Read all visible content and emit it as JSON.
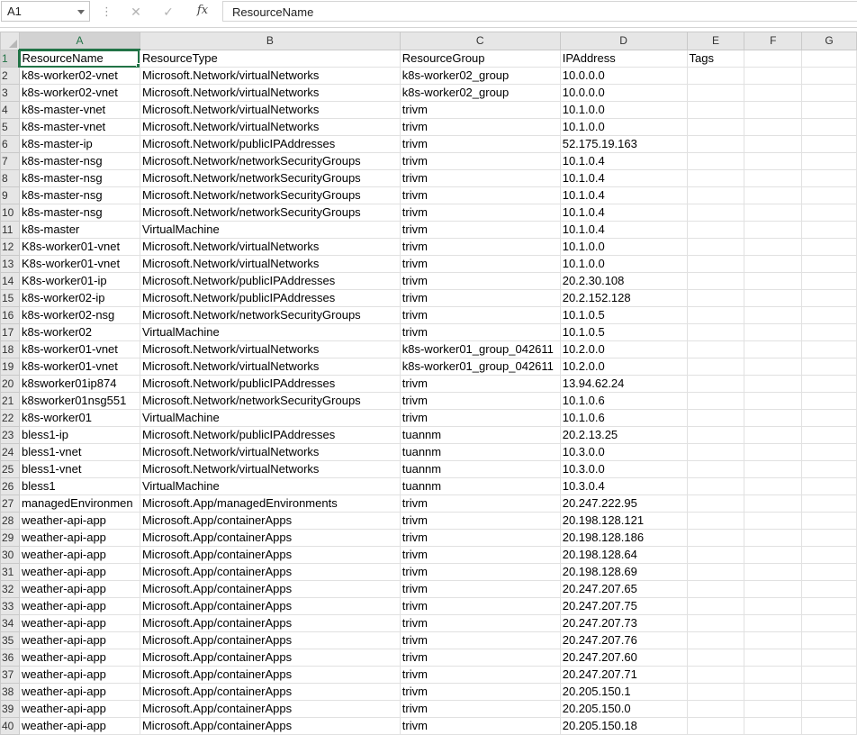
{
  "formula_bar": {
    "name_box": "A1",
    "fx_label": "fx",
    "cancel_icon": "x-icon",
    "enter_icon": "check-icon",
    "content": "ResourceName"
  },
  "columns": [
    "A",
    "B",
    "C",
    "D",
    "E",
    "F",
    "G"
  ],
  "rows": [
    {
      "n": "1",
      "cells": [
        "ResourceName",
        "ResourceType",
        "ResourceGroup",
        "IPAddress",
        "Tags",
        "",
        ""
      ]
    },
    {
      "n": "2",
      "cells": [
        "k8s-worker02-vnet",
        "Microsoft.Network/virtualNetworks",
        "k8s-worker02_group",
        "10.0.0.0",
        "",
        "",
        ""
      ]
    },
    {
      "n": "3",
      "cells": [
        "k8s-worker02-vnet",
        "Microsoft.Network/virtualNetworks",
        "k8s-worker02_group",
        "10.0.0.0",
        "",
        "",
        ""
      ]
    },
    {
      "n": "4",
      "cells": [
        "k8s-master-vnet",
        "Microsoft.Network/virtualNetworks",
        "trivm",
        "10.1.0.0",
        "",
        "",
        ""
      ]
    },
    {
      "n": "5",
      "cells": [
        "k8s-master-vnet",
        "Microsoft.Network/virtualNetworks",
        "trivm",
        "10.1.0.0",
        "",
        "",
        ""
      ]
    },
    {
      "n": "6",
      "cells": [
        "k8s-master-ip",
        "Microsoft.Network/publicIPAddresses",
        "trivm",
        "52.175.19.163",
        "",
        "",
        ""
      ]
    },
    {
      "n": "7",
      "cells": [
        "k8s-master-nsg",
        "Microsoft.Network/networkSecurityGroups",
        "trivm",
        "10.1.0.4",
        "",
        "",
        ""
      ]
    },
    {
      "n": "8",
      "cells": [
        "k8s-master-nsg",
        "Microsoft.Network/networkSecurityGroups",
        "trivm",
        "10.1.0.4",
        "",
        "",
        ""
      ]
    },
    {
      "n": "9",
      "cells": [
        "k8s-master-nsg",
        "Microsoft.Network/networkSecurityGroups",
        "trivm",
        "10.1.0.4",
        "",
        "",
        ""
      ]
    },
    {
      "n": "10",
      "cells": [
        "k8s-master-nsg",
        "Microsoft.Network/networkSecurityGroups",
        "trivm",
        "10.1.0.4",
        "",
        "",
        ""
      ]
    },
    {
      "n": "11",
      "cells": [
        "k8s-master",
        "VirtualMachine",
        "trivm",
        "10.1.0.4",
        "",
        "",
        ""
      ]
    },
    {
      "n": "12",
      "cells": [
        "K8s-worker01-vnet",
        "Microsoft.Network/virtualNetworks",
        "trivm",
        "10.1.0.0",
        "",
        "",
        ""
      ]
    },
    {
      "n": "13",
      "cells": [
        "K8s-worker01-vnet",
        "Microsoft.Network/virtualNetworks",
        "trivm",
        "10.1.0.0",
        "",
        "",
        ""
      ]
    },
    {
      "n": "14",
      "cells": [
        "K8s-worker01-ip",
        "Microsoft.Network/publicIPAddresses",
        "trivm",
        "20.2.30.108",
        "",
        "",
        ""
      ]
    },
    {
      "n": "15",
      "cells": [
        "k8s-worker02-ip",
        "Microsoft.Network/publicIPAddresses",
        "trivm",
        "20.2.152.128",
        "",
        "",
        ""
      ]
    },
    {
      "n": "16",
      "cells": [
        "k8s-worker02-nsg",
        "Microsoft.Network/networkSecurityGroups",
        "trivm",
        "10.1.0.5",
        "",
        "",
        ""
      ]
    },
    {
      "n": "17",
      "cells": [
        "k8s-worker02",
        "VirtualMachine",
        "trivm",
        "10.1.0.5",
        "",
        "",
        ""
      ]
    },
    {
      "n": "18",
      "cells": [
        "k8s-worker01-vnet",
        "Microsoft.Network/virtualNetworks",
        "k8s-worker01_group_042611",
        "10.2.0.0",
        "",
        "",
        ""
      ]
    },
    {
      "n": "19",
      "cells": [
        "k8s-worker01-vnet",
        "Microsoft.Network/virtualNetworks",
        "k8s-worker01_group_042611",
        "10.2.0.0",
        "",
        "",
        ""
      ]
    },
    {
      "n": "20",
      "cells": [
        "k8sworker01ip874",
        "Microsoft.Network/publicIPAddresses",
        "trivm",
        "13.94.62.24",
        "",
        "",
        ""
      ]
    },
    {
      "n": "21",
      "cells": [
        "k8sworker01nsg551",
        "Microsoft.Network/networkSecurityGroups",
        "trivm",
        "10.1.0.6",
        "",
        "",
        ""
      ]
    },
    {
      "n": "22",
      "cells": [
        "k8s-worker01",
        "VirtualMachine",
        "trivm",
        "10.1.0.6",
        "",
        "",
        ""
      ]
    },
    {
      "n": "23",
      "cells": [
        "bless1-ip",
        "Microsoft.Network/publicIPAddresses",
        "tuannm",
        "20.2.13.25",
        "",
        "",
        ""
      ]
    },
    {
      "n": "24",
      "cells": [
        "bless1-vnet",
        "Microsoft.Network/virtualNetworks",
        "tuannm",
        "10.3.0.0",
        "",
        "",
        ""
      ]
    },
    {
      "n": "25",
      "cells": [
        "bless1-vnet",
        "Microsoft.Network/virtualNetworks",
        "tuannm",
        "10.3.0.0",
        "",
        "",
        ""
      ]
    },
    {
      "n": "26",
      "cells": [
        "bless1",
        "VirtualMachine",
        "tuannm",
        "10.3.0.4",
        "",
        "",
        ""
      ]
    },
    {
      "n": "27",
      "cells": [
        "managedEnvironmen",
        "Microsoft.App/managedEnvironments",
        "trivm",
        "20.247.222.95",
        "",
        "",
        ""
      ]
    },
    {
      "n": "28",
      "cells": [
        "weather-api-app",
        "Microsoft.App/containerApps",
        "trivm",
        "20.198.128.121",
        "",
        "",
        ""
      ]
    },
    {
      "n": "29",
      "cells": [
        "weather-api-app",
        "Microsoft.App/containerApps",
        "trivm",
        "20.198.128.186",
        "",
        "",
        ""
      ]
    },
    {
      "n": "30",
      "cells": [
        "weather-api-app",
        "Microsoft.App/containerApps",
        "trivm",
        "20.198.128.64",
        "",
        "",
        ""
      ]
    },
    {
      "n": "31",
      "cells": [
        "weather-api-app",
        "Microsoft.App/containerApps",
        "trivm",
        "20.198.128.69",
        "",
        "",
        ""
      ]
    },
    {
      "n": "32",
      "cells": [
        "weather-api-app",
        "Microsoft.App/containerApps",
        "trivm",
        "20.247.207.65",
        "",
        "",
        ""
      ]
    },
    {
      "n": "33",
      "cells": [
        "weather-api-app",
        "Microsoft.App/containerApps",
        "trivm",
        "20.247.207.75",
        "",
        "",
        ""
      ]
    },
    {
      "n": "34",
      "cells": [
        "weather-api-app",
        "Microsoft.App/containerApps",
        "trivm",
        "20.247.207.73",
        "",
        "",
        ""
      ]
    },
    {
      "n": "35",
      "cells": [
        "weather-api-app",
        "Microsoft.App/containerApps",
        "trivm",
        "20.247.207.76",
        "",
        "",
        ""
      ]
    },
    {
      "n": "36",
      "cells": [
        "weather-api-app",
        "Microsoft.App/containerApps",
        "trivm",
        "20.247.207.60",
        "",
        "",
        ""
      ]
    },
    {
      "n": "37",
      "cells": [
        "weather-api-app",
        "Microsoft.App/containerApps",
        "trivm",
        "20.247.207.71",
        "",
        "",
        ""
      ]
    },
    {
      "n": "38",
      "cells": [
        "weather-api-app",
        "Microsoft.App/containerApps",
        "trivm",
        "20.205.150.1",
        "",
        "",
        ""
      ]
    },
    {
      "n": "39",
      "cells": [
        "weather-api-app",
        "Microsoft.App/containerApps",
        "trivm",
        "20.205.150.0",
        "",
        "",
        ""
      ]
    },
    {
      "n": "40",
      "cells": [
        "weather-api-app",
        "Microsoft.App/containerApps",
        "trivm",
        "20.205.150.18",
        "",
        "",
        ""
      ]
    }
  ],
  "selection": {
    "column": "A",
    "row": "1"
  },
  "colors": {
    "accent": "#217346",
    "header_bg": "#e6e6e6",
    "gridline": "#e1e1e1"
  }
}
